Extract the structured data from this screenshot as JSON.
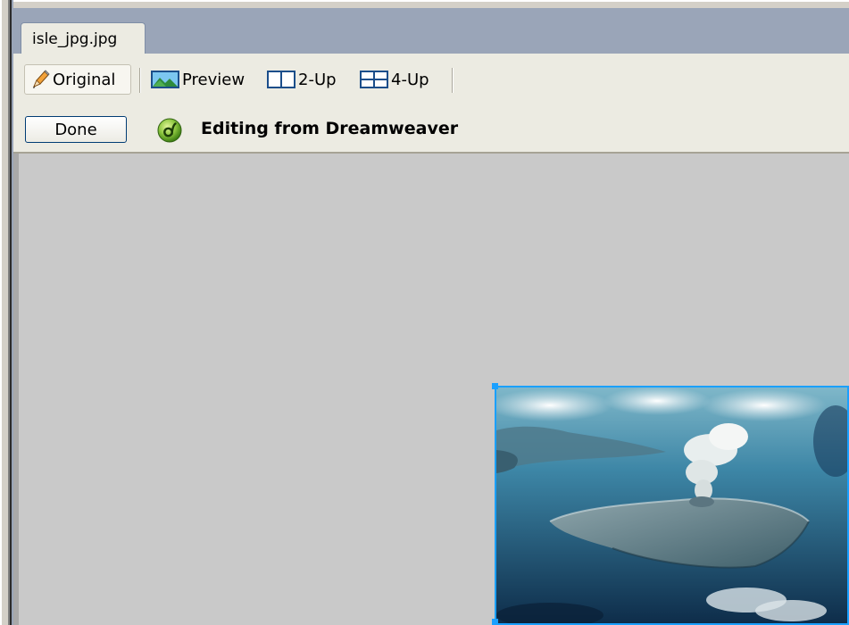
{
  "document_tab": {
    "label": "isle_jpg.jpg"
  },
  "view_toolbar": {
    "buttons": [
      {
        "label": "Original",
        "icon": "pencil-icon",
        "active": true
      },
      {
        "label": "Preview",
        "icon": "landscape-icon",
        "active": false
      },
      {
        "label": "2-Up",
        "icon": "two-up-icon",
        "active": false
      },
      {
        "label": "4-Up",
        "icon": "four-up-icon",
        "active": false
      }
    ]
  },
  "edit_bar": {
    "done_label": "Done",
    "icon": "dreamweaver-icon",
    "status_text": "Editing from Dreamweaver"
  },
  "canvas": {
    "background": "#c9c9c9",
    "selection_color": "#1aa0ff",
    "image": {
      "icon": "volcanic-island-photo"
    }
  },
  "colors": {
    "tab_strip": "#9aa5b8",
    "toolbar": "#ecebe2",
    "done_border": "#003c74"
  }
}
